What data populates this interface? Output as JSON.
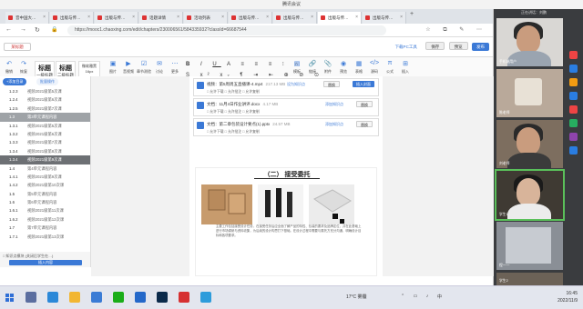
{
  "window_title": "腾讯会议",
  "browser": {
    "tabs": [
      "音中国大…",
      "出版与传…",
      "出版与传…",
      "话题详情",
      "活动列表",
      "出版与传…",
      "出版与传…",
      "出版与传…",
      "出版与传…"
    ],
    "url": "https://mooc1.chaoxing.com/edit/chapters/230006561/584335932?classId=66687544"
  },
  "editor": {
    "logo": "某标题",
    "download": "下载PC工具",
    "save": "保存",
    "preview": "预览",
    "publish": "发布",
    "toolbar": {
      "undo": "撤销",
      "redo": "恢复",
      "style_heading": "标题",
      "style_heading_sub": "一级标题",
      "style_body": "标题",
      "style_body_sub": "二级标题",
      "font": "微软雅黑",
      "size": "16px",
      "items": [
        "图片",
        "音视频",
        "章节测验",
        "讨论",
        "更多",
        "模板",
        "链接",
        "附件",
        "预览",
        "表格",
        "源码",
        "公式",
        "插入"
      ]
    }
  },
  "sidebar": {
    "add_chapter": "+添加目录",
    "batch": "批量操作",
    "rows": [
      {
        "n": "1.2.3",
        "t": "视频2021级第5次课"
      },
      {
        "n": "1.2.4",
        "t": "视频2021级第6次课"
      },
      {
        "n": "1.2.5",
        "t": "视频2021级第7次课"
      },
      {
        "n": "1.3",
        "t": "第3单元课程内容",
        "state": "hl"
      },
      {
        "n": "1.3.1",
        "t": "视频2021级第5次课"
      },
      {
        "n": "1.3.2",
        "t": "视频2021级第6次课"
      },
      {
        "n": "1.3.3",
        "t": "视频2021级第7次课"
      },
      {
        "n": "1.3.4",
        "t": "视频2021级第8次课"
      },
      {
        "n": "1.3.4",
        "t": "视频2021级第9次课",
        "state": "sel"
      },
      {
        "n": "1.4",
        "t": "第4单元课程内容"
      },
      {
        "n": "1.4.1",
        "t": "视频2021级第9次课"
      },
      {
        "n": "1.4.2",
        "t": "视频2021级第10次课"
      },
      {
        "n": "1.5",
        "t": "第5单元课程内容"
      },
      {
        "n": "1.6",
        "t": "第6单元课程内容"
      },
      {
        "n": "1.6.1",
        "t": "视频2021级第11次课"
      },
      {
        "n": "1.6.2",
        "t": "视频2021级第12次课"
      },
      {
        "n": "1.7",
        "t": "第7单元课程内容"
      },
      {
        "n": "1.7.1",
        "t": "视频2021级第13次课"
      }
    ],
    "footer_note": "□ 知识点模块  (关闭后学生在…)",
    "footer_btn": "插入内容"
  },
  "attachments": [
    {
      "name": "视频：第5周周五直播课-4.mp4",
      "size": "217.13 MB",
      "b1": "设为知识点",
      "b2": "替换",
      "b3": "插入封面"
    },
    {
      "name": "文档：11月4日作业讲评.docx",
      "size": "4.17 MB",
      "b1": "添加知识点",
      "b2": "替换"
    },
    {
      "name": "文档：第二章包装设计要点(1).pptx",
      "size": "24.57 MB",
      "b1": "添加知识点",
      "b2": "替换"
    }
  ],
  "opt_labels": "□ 允许下载   □ 允许批注   □ 允许复制",
  "slide": {
    "title": "（二） 接受委托",
    "caption": "主要工作包括接受设计任务，在接受任务后应全面了解产品的特性、包装的要求及品牌定位，并在此基础上进行市场调研与资料收集，为后续的设计构思打下基础。在设计过程中需要与委托方充分沟通，明确设计目标和各项要求。"
  },
  "meeting": {
    "status": "正在讲话：刘鹏",
    "participants": [
      "手机端用户",
      "陈老师",
      "刘老师",
      "学生1",
      "程一一",
      "学生2"
    ]
  },
  "taskbar": {
    "weather": "17°C  雾霾",
    "ime": "中",
    "time": "16:45",
    "date": "2022/11/9"
  }
}
